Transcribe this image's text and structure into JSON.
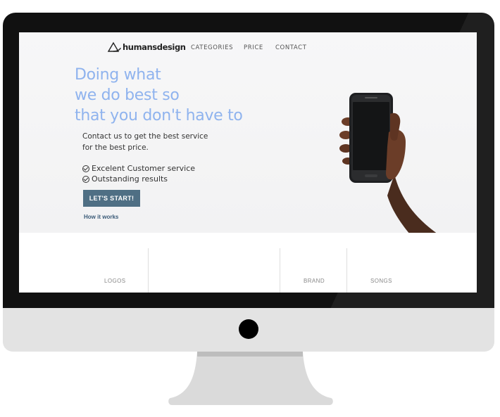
{
  "brand": {
    "name": "humansdesign"
  },
  "nav": {
    "items": [
      {
        "label": "CATEGORIES"
      },
      {
        "label": "PRICE"
      },
      {
        "label": "CONTACT"
      }
    ]
  },
  "hero": {
    "headline": [
      "Doing what",
      "we do best so",
      "that you don't have to"
    ],
    "tagline": [
      "Contact us to get the best service",
      "for the best price."
    ],
    "features": [
      "Excelent Customer service",
      "Outstanding results"
    ],
    "cta_label": "LET'S START!",
    "secondary_link": "How it works"
  },
  "categories": [
    "LOGOS",
    "BRAND",
    "SONGS"
  ],
  "colors": {
    "headline": "#8fb3ee",
    "cta_background": "#4f6f84",
    "monitor_bezel": "#111111",
    "monitor_chin": "#e3e3e3"
  },
  "icons": [
    "humansdesign-logo-icon",
    "check-circle-icon",
    "phone-in-hand-image"
  ]
}
